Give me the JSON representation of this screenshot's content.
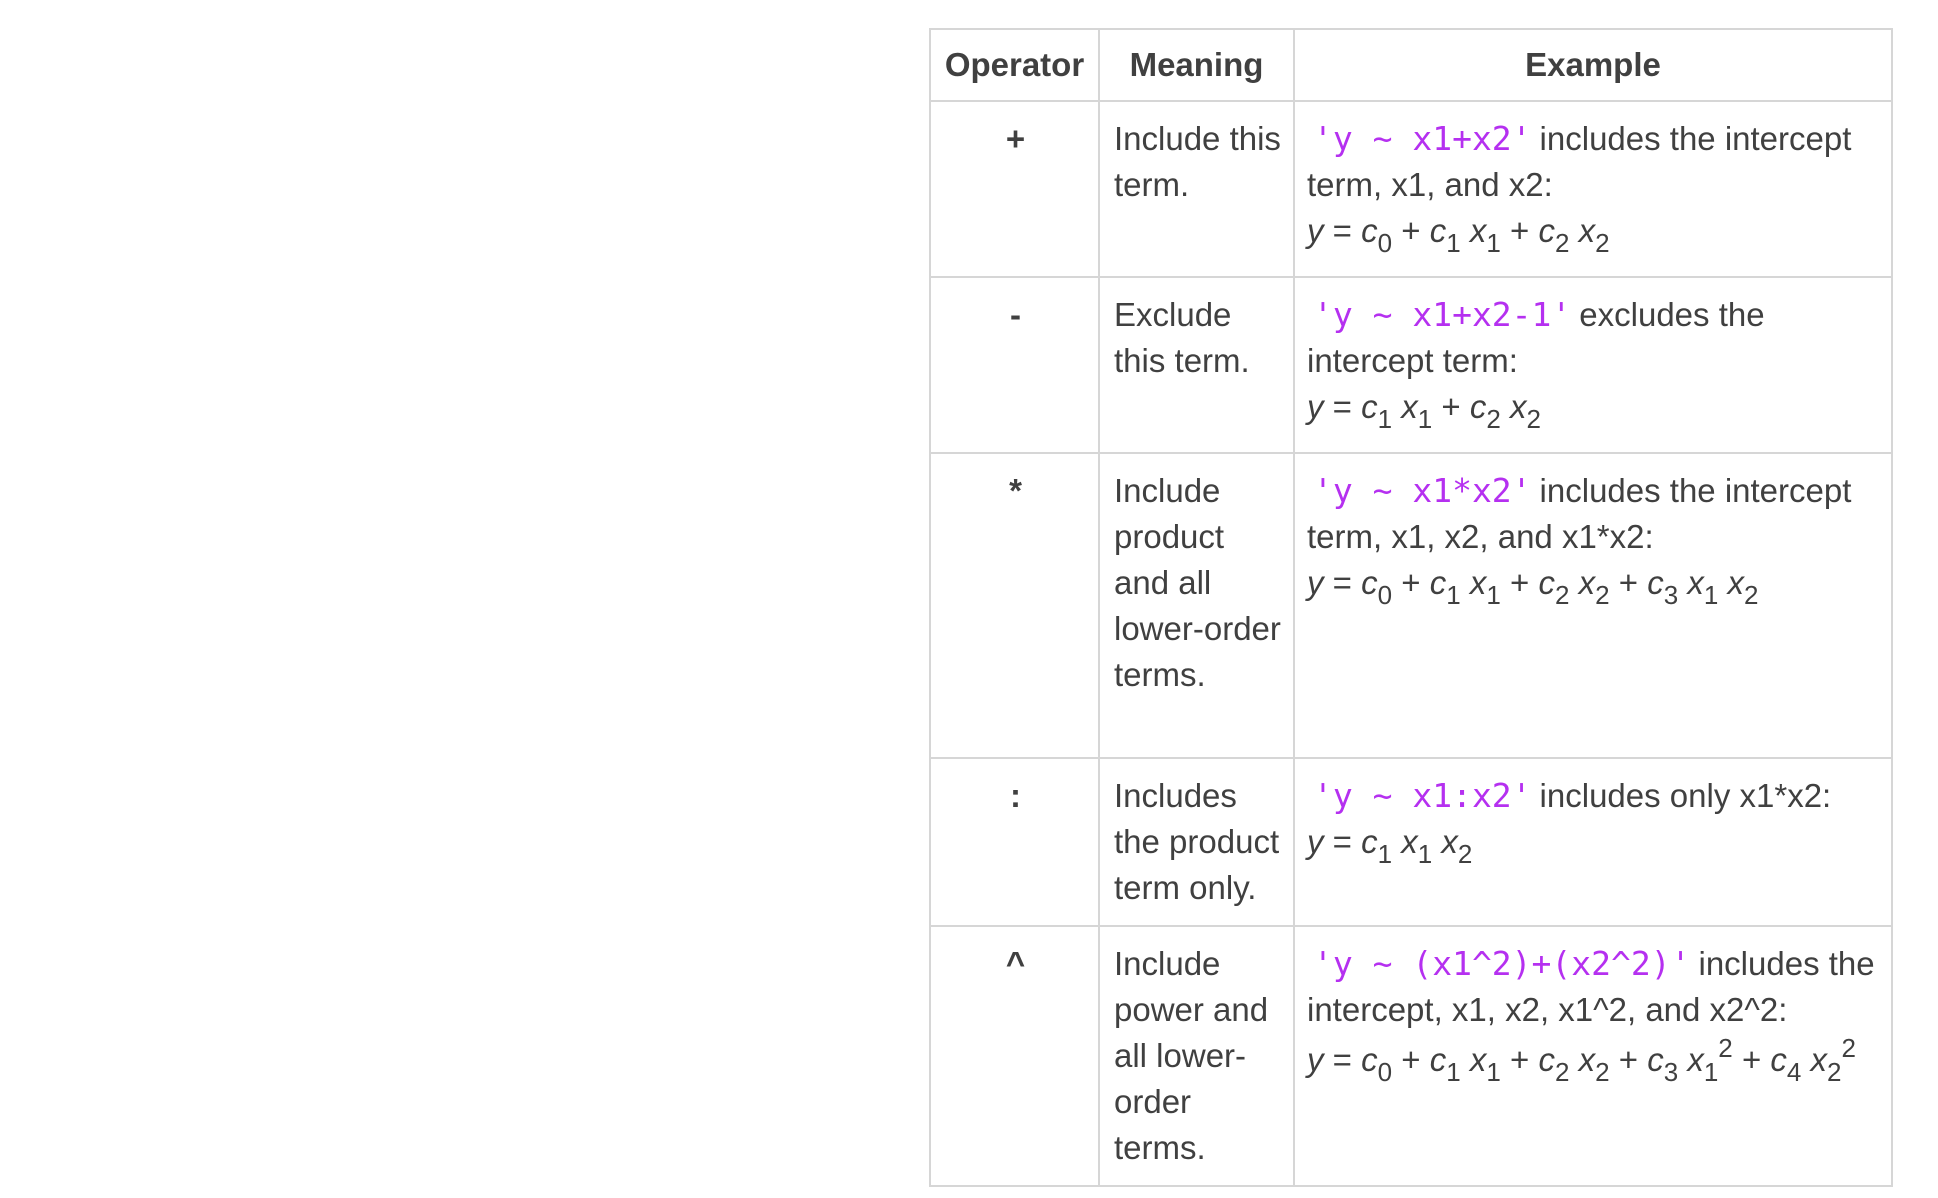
{
  "table": {
    "headers": {
      "operator": "Operator",
      "meaning": "Meaning",
      "example": "Example"
    },
    "rows": [
      {
        "operator": "+",
        "meaning": "Include this term.",
        "code": "'y ~ x1+x2'",
        "description": "includes the intercept term, x1, and x2:",
        "equation": "y = c0 + c1 x1 + c2 x2"
      },
      {
        "operator": "-",
        "meaning": "Exclude this term.",
        "code": "'y ~ x1+x2-1'",
        "description": "excludes the intercept term:",
        "equation": "y = c1 x1 + c2 x2"
      },
      {
        "operator": "*",
        "meaning": "Include product and all lower-order terms.",
        "code": "'y ~ x1*x2'",
        "description": "includes the intercept term, x1, x2, and x1*x2:",
        "equation": "y = c0 + c1 x1 + c2 x2 + c3 x1 x2"
      },
      {
        "operator": ":",
        "meaning": "Includes the product term only.",
        "code": "'y ~ x1:x2'",
        "description": "includes only x1*x2:",
        "equation": "y = c1 x1 x2"
      },
      {
        "operator": "^",
        "meaning": "Include power and all lower-order terms.",
        "code": "'y ~ (x1^2)+(x2^2)'",
        "description": "includes the intercept, x1, x2, x1^2, and x2^2:",
        "equation": "y = c0 + c1 x1 + c2 x2 + c3 x1^2 + c4 x2^2"
      }
    ]
  }
}
